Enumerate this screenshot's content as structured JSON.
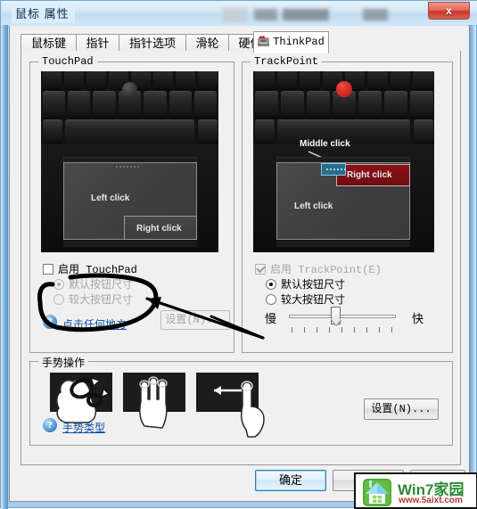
{
  "window": {
    "title": "鼠标 属性",
    "close_label": "x"
  },
  "tabs": [
    {
      "label": "鼠标键",
      "active": false
    },
    {
      "label": "指针",
      "active": false
    },
    {
      "label": "指针选项",
      "active": false
    },
    {
      "label": "滑轮",
      "active": false
    },
    {
      "label": "硬件",
      "active": false
    },
    {
      "label": "ThinkPad",
      "active": true
    }
  ],
  "touchpad": {
    "group_title": "TouchPad",
    "image": {
      "left_click": "Left click",
      "right_click": "Right click"
    },
    "enable_label": "启用 TouchPad",
    "enable_checked": false,
    "radio_default": "默认按钮尺寸",
    "radio_large": "较大按钮尺寸",
    "radio_selected": "default",
    "help_link": "点击任何地方",
    "settings_button": "设置(N)...",
    "settings_enabled": false
  },
  "trackpoint": {
    "group_title": "TrackPoint",
    "image": {
      "middle_click": "Middle click",
      "right_click": "Right click",
      "left_click": "Left click"
    },
    "enable_label": "启用 TrackPoint(E)",
    "enable_checked": true,
    "radio_default": "默认按钮尺寸",
    "radio_large": "较大按钮尺寸",
    "radio_selected": "default",
    "slider_min_label": "慢",
    "slider_max_label": "快",
    "slider_value": 4,
    "slider_ticks": 9
  },
  "gestures": {
    "group_title": "手势操作",
    "help_link": "手势类型",
    "settings_button": "设置(N)...",
    "tiles": [
      {
        "name": "zoom-rotate-gesture"
      },
      {
        "name": "three-finger-gesture"
      },
      {
        "name": "swipe-left-gesture"
      }
    ]
  },
  "footer": {
    "ok_button": "确定",
    "cancel_button": "",
    "apply_button": ""
  },
  "watermark": {
    "title": "Win7家园",
    "url": "www.5aixt.com"
  },
  "annotations": {
    "ellipse_note": "hand-drawn ellipse around 启用 TouchPad option",
    "arrow_note": "hand-drawn arrow pointing at the TouchPad enable checkbox"
  }
}
